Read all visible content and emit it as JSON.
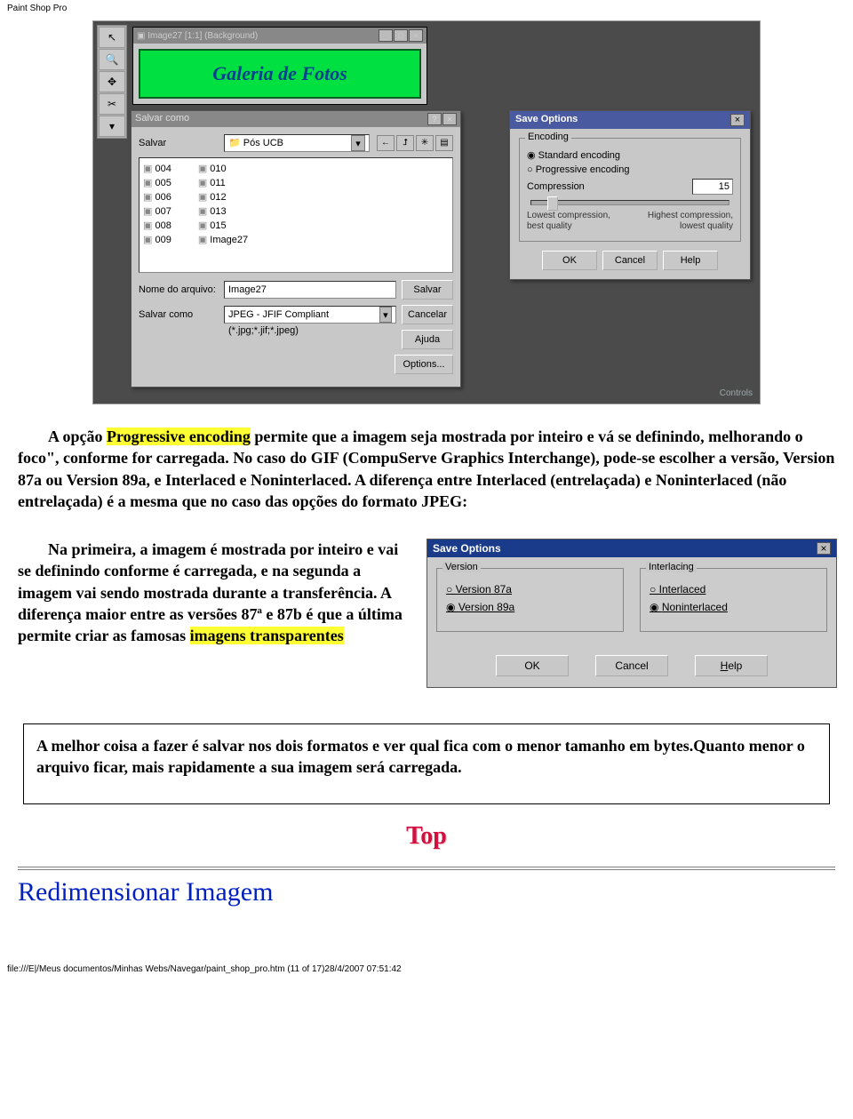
{
  "page_header": "Paint Shop Pro",
  "screenshot1": {
    "image_window_title": "Image27 [1:1] (Background)",
    "banner_text": "Galeria de Fotos",
    "save_dialog": {
      "title": "Salvar como",
      "save_in_label": "Salvar",
      "save_in_value": "Pós UCB",
      "files_col1": [
        "004",
        "005",
        "006",
        "007",
        "008",
        "009"
      ],
      "files_col2": [
        "010",
        "011",
        "012",
        "013",
        "015",
        "Image27"
      ],
      "filename_label": "Nome do arquivo:",
      "filename_value": "Image27",
      "save_as_label": "Salvar como",
      "save_as_value": "JPEG - JFIF Compliant (*.jpg;*.jif;*.jpeg)",
      "btn_save": "Salvar",
      "btn_cancel": "Cancelar",
      "btn_help": "Ajuda",
      "btn_options": "Options..."
    },
    "save_options": {
      "title": "Save Options",
      "encoding_legend": "Encoding",
      "opt_standard": "Standard encoding",
      "opt_progressive": "Progressive encoding",
      "compression_label": "Compression",
      "compression_value": "15",
      "low_label_a": "Lowest compression,",
      "low_label_b": "best quality",
      "high_label_a": "Highest compression,",
      "high_label_b": "lowest quality",
      "btn_ok": "OK",
      "btn_cancel": "Cancel",
      "btn_help": "Help"
    },
    "controls_label": "Controls"
  },
  "para1_a": "A opção ",
  "para1_hl": "Progressive encoding",
  "para1_b": " permite que a imagem seja mostrada por inteiro e vá se definindo, melhorando o foco\", conforme for carregada. No caso do GIF (CompuServe Graphics Interchange), pode-se escolher a versão, Version 87a ou Version 89a, e Interlaced e Noninterlaced. A diferença entre Interlaced (entrelaçada) e Noninterlaced (não entrelaçada) é a mesma que no caso das opções do formato JPEG:",
  "para2_a": "Na primeira, a imagem é mostrada por inteiro e vai se definindo conforme é carregada, e na segunda a imagem vai sendo mostrada durante a transferência. A diferença maior entre as versões 87ª e 87b é que a última permite criar as famosas ",
  "para2_hl": "imagens transparentes",
  "so2": {
    "title": "Save Options",
    "version_legend": "Version",
    "v87": "Version 87a",
    "v89": "Version 89a",
    "interlacing_legend": "Interlacing",
    "interlaced": "Interlaced",
    "noninterlaced": "Noninterlaced",
    "btn_ok": "OK",
    "btn_cancel": "Cancel",
    "btn_help": "Help"
  },
  "tip": "A melhor coisa a fazer é salvar nos dois formatos e ver qual fica com o menor tamanho em bytes.Quanto menor o arquivo ficar, mais rapidamente a sua imagem será carregada.",
  "top_text": "Top",
  "h2": "Redimensionar Imagem",
  "footer": "file:///E|/Meus documentos/Minhas Webs/Navegar/paint_shop_pro.htm (11 of 17)28/4/2007 07:51:42"
}
